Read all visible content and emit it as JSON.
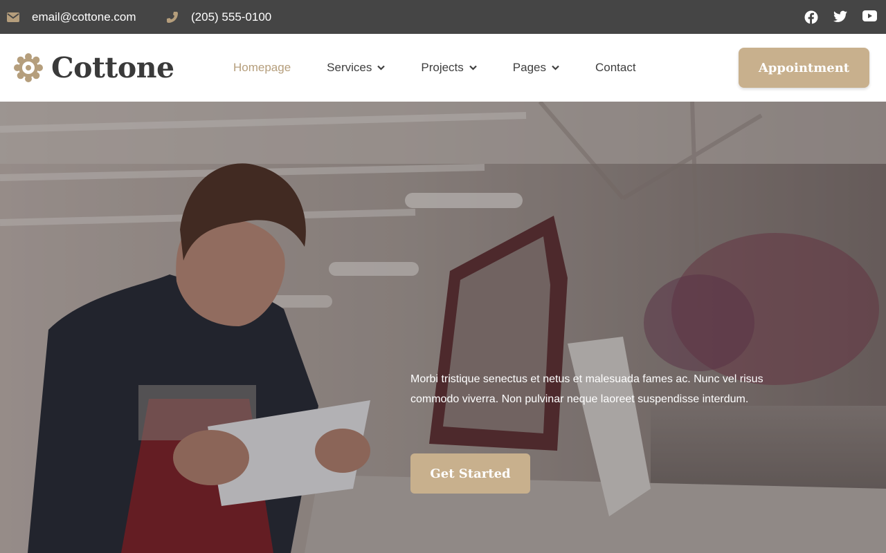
{
  "topbar": {
    "email": "email@cottone.com",
    "phone": "(205) 555-0100",
    "icons": {
      "email": "envelope-icon",
      "phone": "phone-icon",
      "social": [
        "facebook-icon",
        "twitter-icon",
        "youtube-icon"
      ]
    }
  },
  "header": {
    "logo_text": "Cottone",
    "nav": [
      {
        "label": "Homepage",
        "active": true,
        "dropdown": false
      },
      {
        "label": "Services",
        "active": false,
        "dropdown": true
      },
      {
        "label": "Projects",
        "active": false,
        "dropdown": true
      },
      {
        "label": "Pages",
        "active": false,
        "dropdown": true
      },
      {
        "label": "Contact",
        "active": false,
        "dropdown": false
      }
    ],
    "cta_label": "Appointment"
  },
  "hero": {
    "body": "Morbi tristique senectus et netus et malesuada fames ac. Nunc vel risus commodo viverra. Non pulvinar neque laoreet suspendisse interdum.",
    "cta_label": "Get Started"
  },
  "colors": {
    "topbar_bg": "#454545",
    "accent": "#c8b08d",
    "nav_active": "#b59e7c",
    "text_dark": "#3e3e3e"
  }
}
